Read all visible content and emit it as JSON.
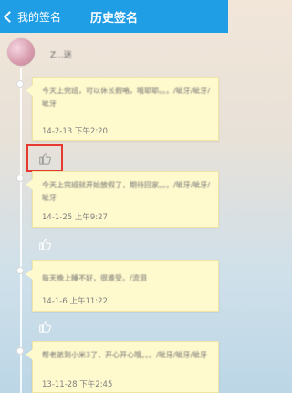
{
  "header": {
    "back_label": "我的签名",
    "title": "历史签名"
  },
  "profile": {
    "name": "Z...迷"
  },
  "signatures": [
    {
      "text": "今天上完班，可以休长假咯，哦耶耶。。。/呲牙/呲牙/呲牙",
      "time": "14-2-13 下午2:20"
    },
    {
      "text": "今天上完班就开始放假了，期待回家。。。/呲牙/呲牙/呲牙",
      "time": "14-1-25 上午9:27"
    },
    {
      "text": "每天晚上睡不好，很难受。/流泪",
      "time": "14-1-6 上午11:22"
    },
    {
      "text": "帮老弟到小米3了，开心开心哦。。。/呲牙/呲牙/呲牙",
      "time": "13-11-28 下午2:45"
    }
  ],
  "icons": {
    "like": "thumbs-up-icon"
  },
  "colors": {
    "header": "#1f9de5",
    "card": "#fff9ce",
    "highlight": "#e53a2f"
  }
}
